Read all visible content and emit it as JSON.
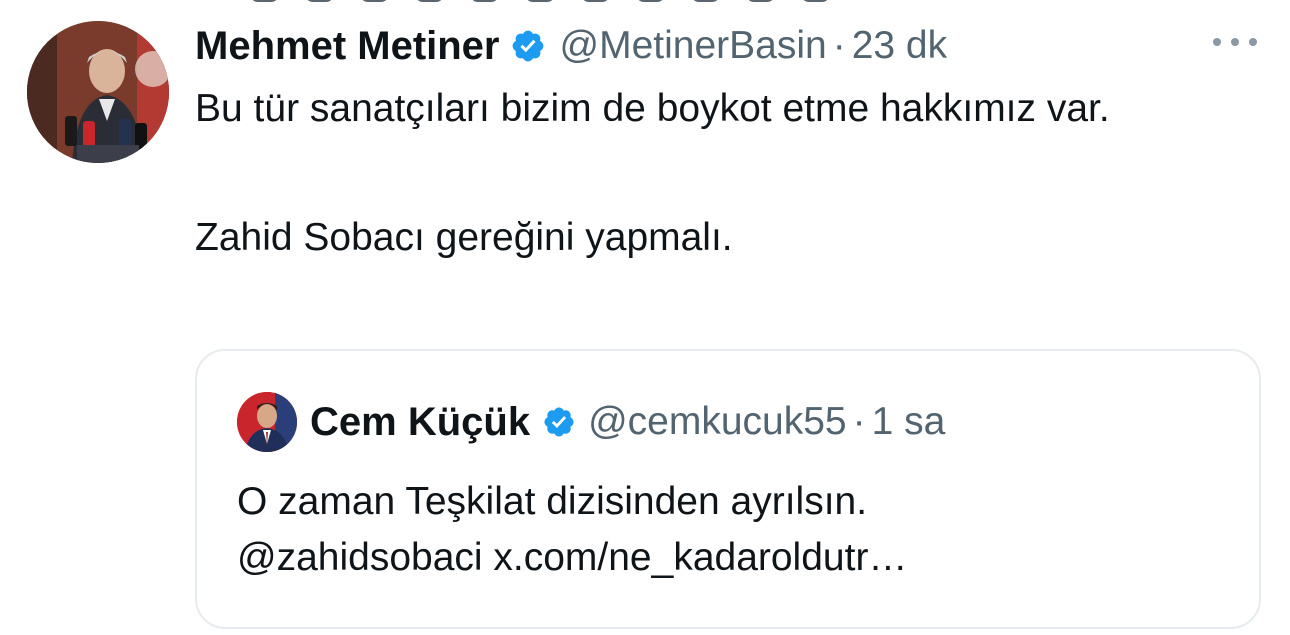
{
  "tweet": {
    "display_name": "Mehmet Metiner",
    "handle": "@MetinerBasin",
    "separator": "·",
    "time": "23 dk",
    "lines": [
      "Bu tür sanatçıları bizim de boykot etme hakkımız var.",
      "Zahid Sobacı gereğini yapmalı."
    ],
    "avatar_icon": "person-at-podium-avatar",
    "verified_icon": "verified-badge-icon",
    "more_icon": "more-options-icon"
  },
  "quote": {
    "display_name": "Cem Küçük",
    "handle": "@cemkucuk55",
    "separator": "·",
    "time": "1 sa",
    "line1": "O zaman Teşkilat dizisinden ayrılsın.",
    "line2": "@zahidsobaci x.com/ne_kadaroldutr…",
    "avatar_icon": "person-suit-avatar",
    "verified_icon": "verified-badge-icon"
  },
  "colors": {
    "text": "#0f1419",
    "secondary": "#536471",
    "verified": "#1d9bf0",
    "border": "#e6ebef"
  }
}
